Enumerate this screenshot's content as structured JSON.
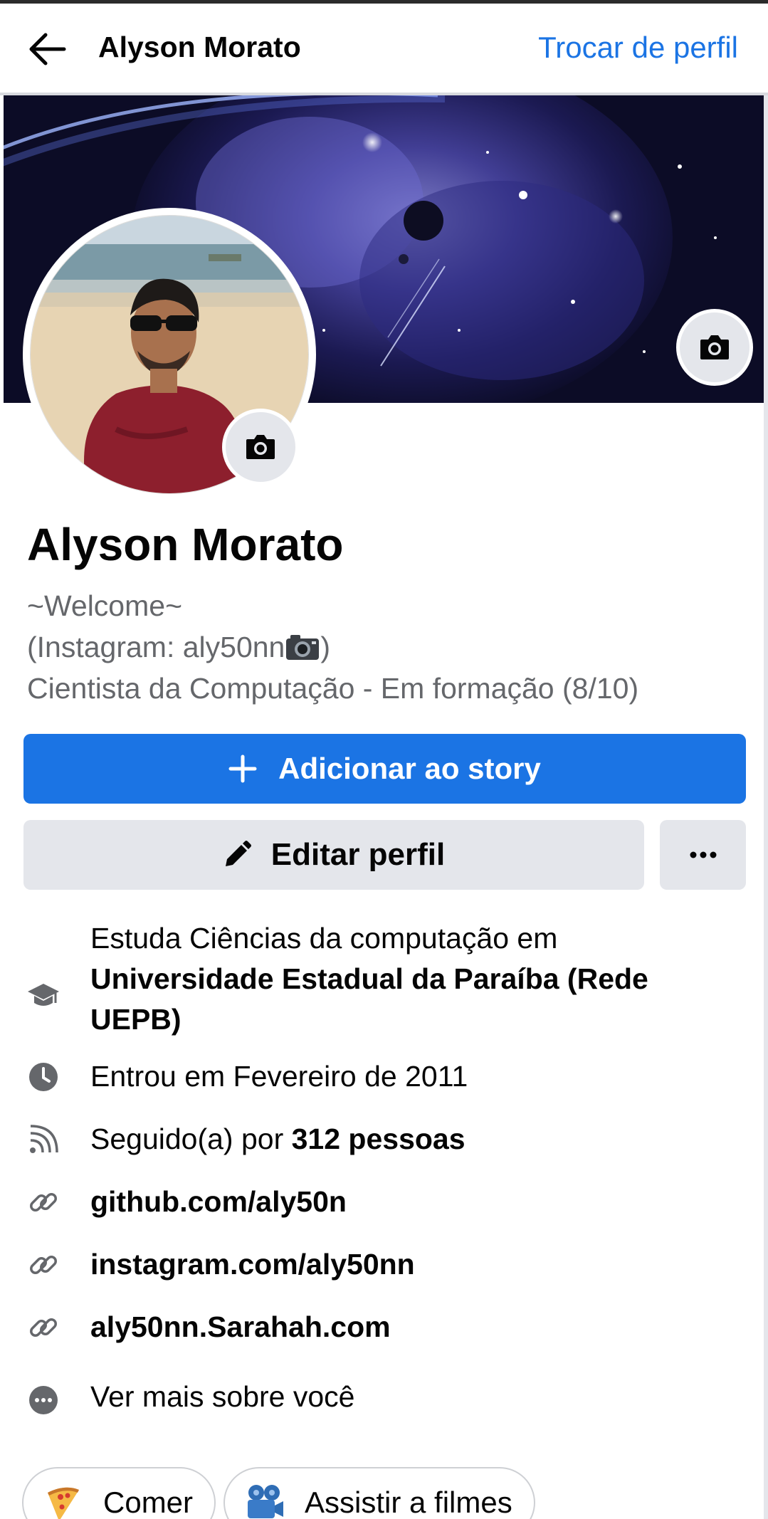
{
  "header": {
    "title": "Alyson Morato",
    "switch_profile": "Trocar de perfil"
  },
  "profile": {
    "name": "Alyson Morato",
    "bio_line1": "~Welcome~",
    "bio_line2": "(Instagram: aly50nn",
    "bio_line2_end": ")",
    "bio_line3": "Cientista da Computação - Em formação (8/10)"
  },
  "actions": {
    "add_story": "Adicionar ao story",
    "edit_profile": "Editar perfil"
  },
  "details": {
    "education_prefix": "Estuda Ciências da computação em",
    "education_school_line1": "Universidade Estadual da Paraíba (Rede",
    "education_school_line2": "UEPB)",
    "joined": "Entrou em Fevereiro de 2011",
    "followers_prefix": "Seguido(a) por ",
    "followers_count": "312 pessoas",
    "link1": "github.com/aly50n",
    "link2": "instagram.com/aly50nn",
    "link3": "aly50nn.Sarahah.com",
    "see_more": "Ver mais sobre você"
  },
  "hobbies": [
    {
      "label": "Comer",
      "icon": "pizza-icon"
    },
    {
      "label": "Assistir a filmes",
      "icon": "film-camera-icon"
    }
  ],
  "colors": {
    "accent": "#1b74e4",
    "button_gray": "#e4e6eb",
    "secondary_text": "#65676b"
  }
}
